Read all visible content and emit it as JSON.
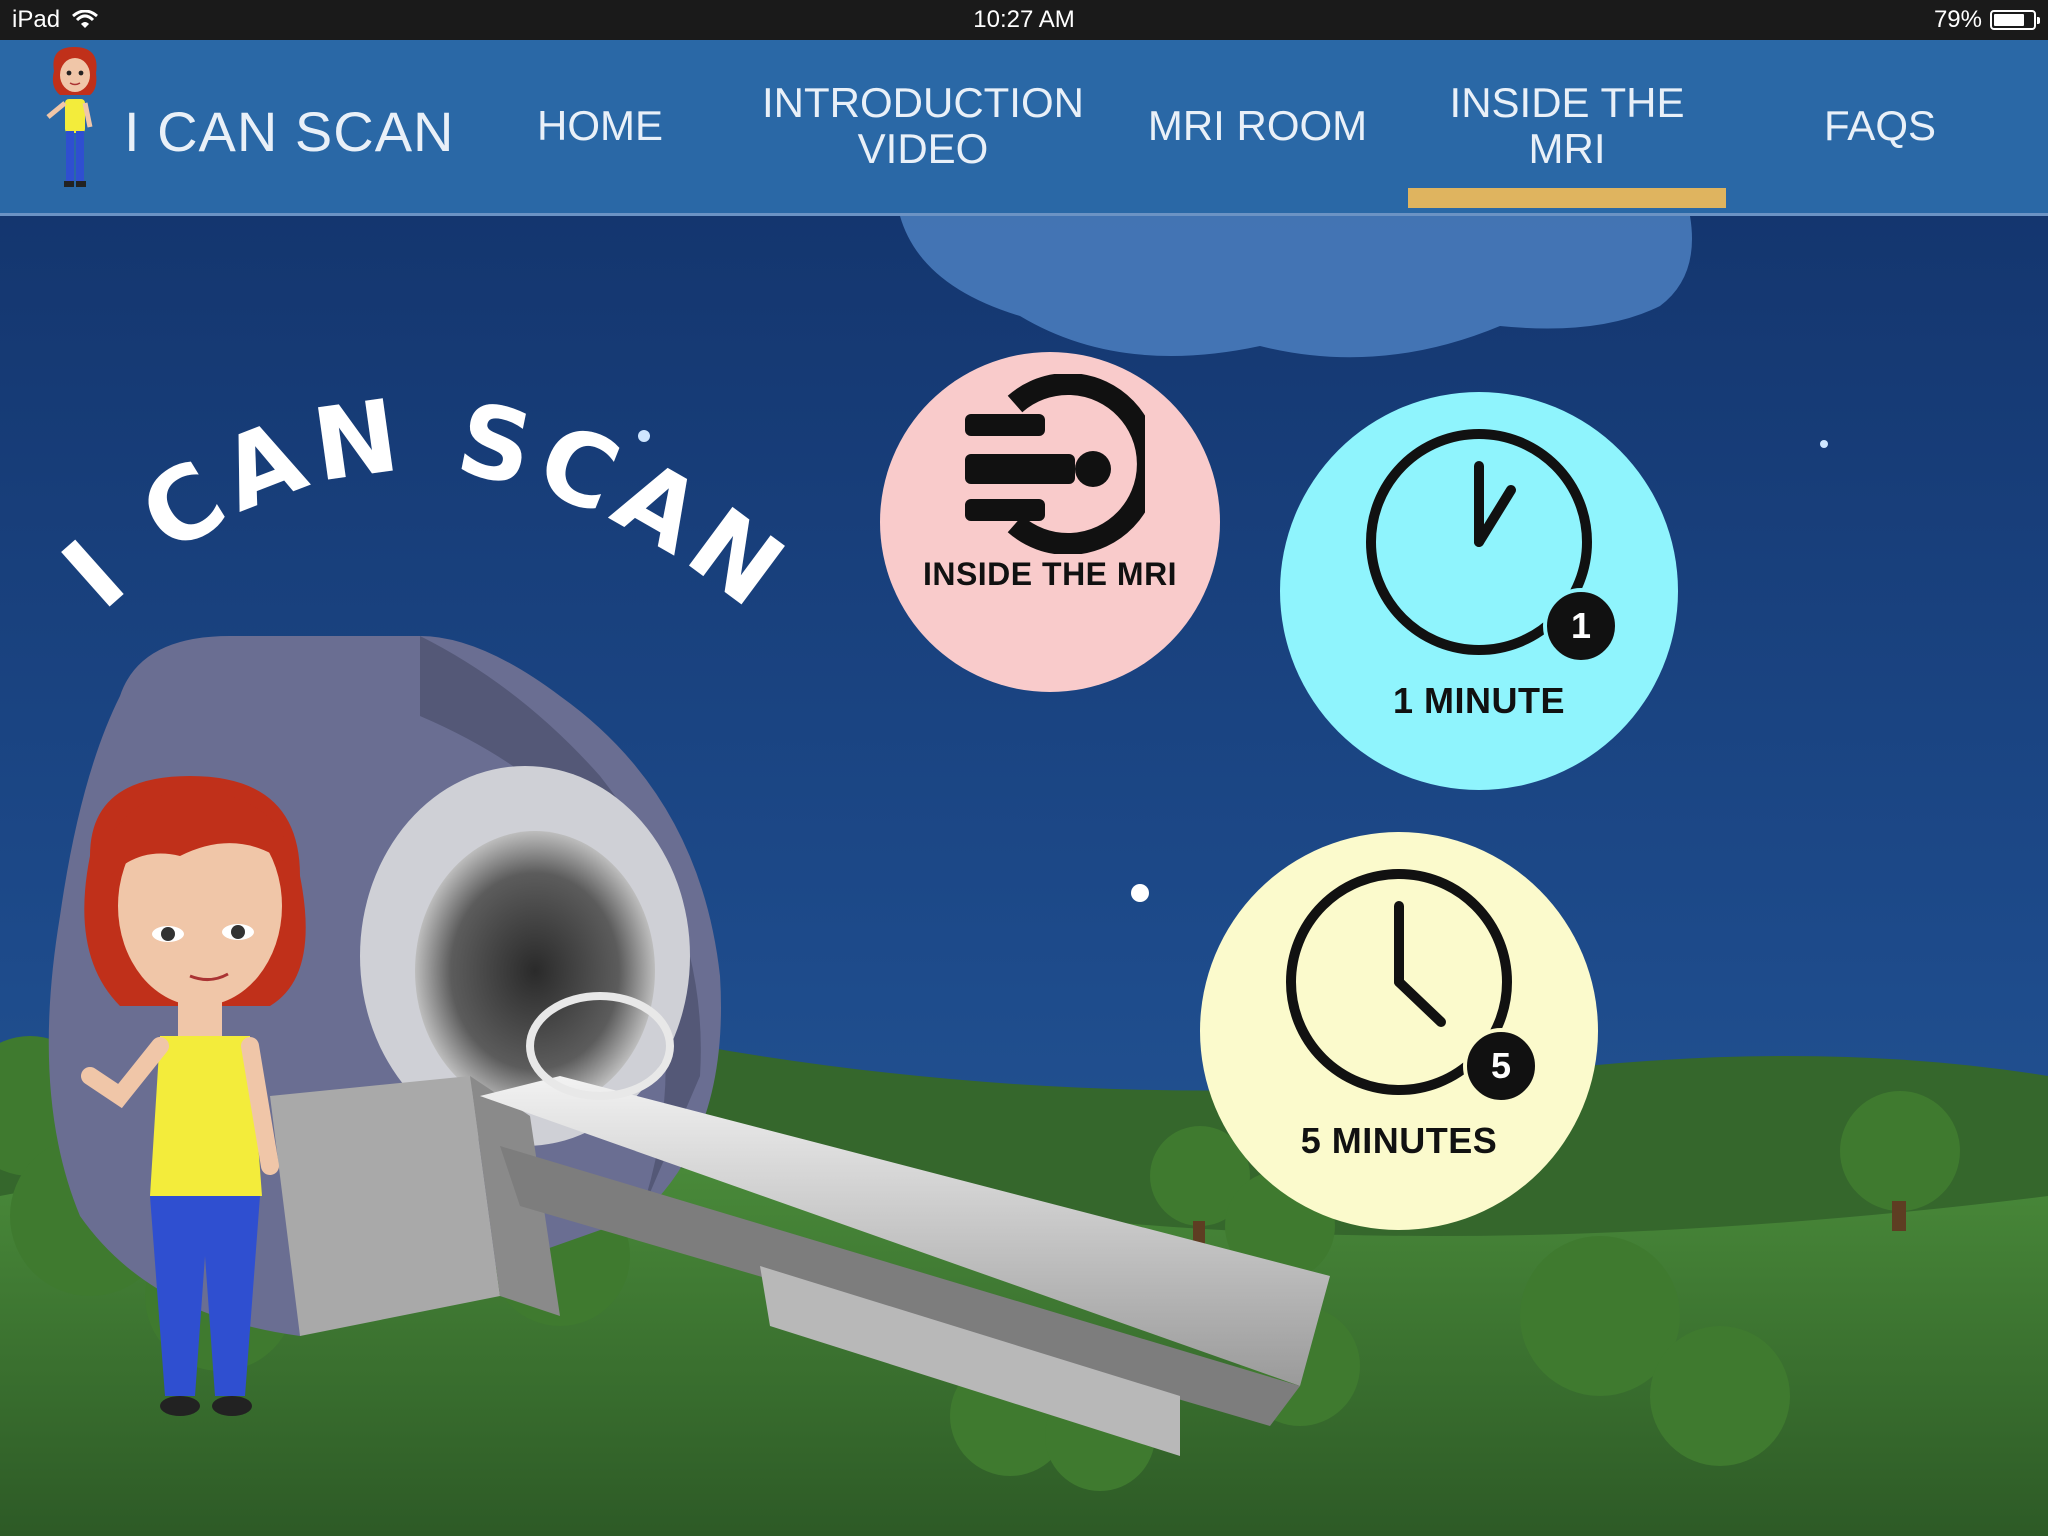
{
  "status_bar": {
    "device": "iPad",
    "time": "10:27 AM",
    "battery": "79%",
    "battery_level": 0.79
  },
  "nav": {
    "brand": "I CAN SCAN",
    "items": [
      {
        "label": "HOME",
        "active": false
      },
      {
        "label": "INTRODUCTION\nVIDEO",
        "active": false
      },
      {
        "label": "MRI ROOM",
        "active": false
      },
      {
        "label": "INSIDE THE\nMRI",
        "active": true
      },
      {
        "label": "FAQS",
        "active": false
      }
    ]
  },
  "hero": {
    "title": "I CAN SCAN"
  },
  "options": [
    {
      "label": "INSIDE THE MRI",
      "icon": "mri-scanner-icon",
      "color": "#f9cbcb"
    },
    {
      "label": "1 MINUTE",
      "badge": "1",
      "icon": "clock-icon",
      "color": "#8ff4fd"
    },
    {
      "label": "5 MINUTES",
      "badge": "5",
      "icon": "clock-icon",
      "color": "#fbfacc"
    }
  ],
  "colors": {
    "nav_bg": "#2a68a6",
    "active_underline": "#dfb45f",
    "sky": "#0d2a5e"
  }
}
